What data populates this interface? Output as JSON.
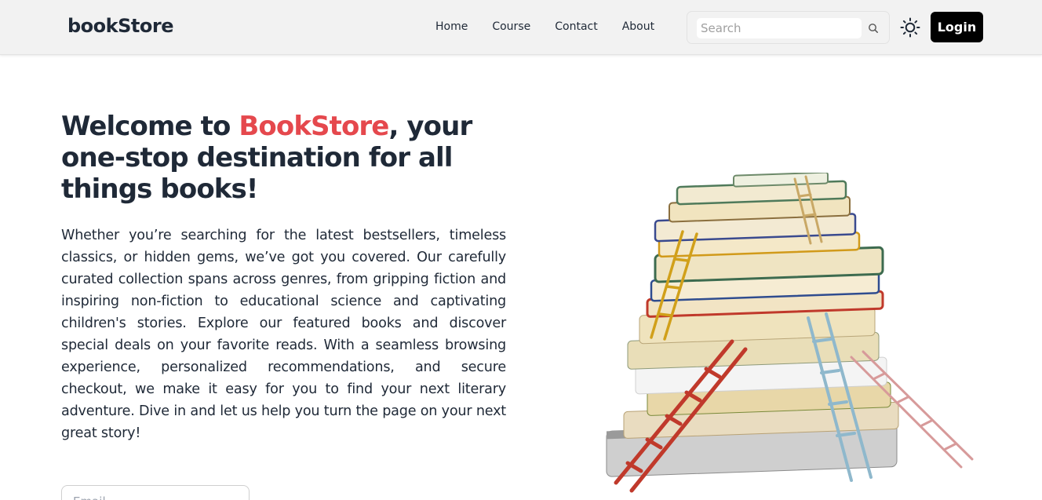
{
  "header": {
    "brand": "bookStore",
    "nav": [
      "Home",
      "Course",
      "Contact",
      "About"
    ],
    "search": {
      "placeholder": "Search",
      "value": "",
      "icon": "search-icon"
    },
    "theme_toggle_icon": "sun-icon",
    "login_label": "Login"
  },
  "hero": {
    "title_prefix": "Welcome to ",
    "title_accent": "BookStore",
    "title_suffix": ", your one-stop destination for all things books!",
    "description": "Whether you’re searching for the latest bestsellers, timeless classics, or hidden gems, we’ve got you covered. Our carefully curated collection spans across genres, from gripping fiction and inspiring non-fiction to educational science and captivating children's stories. Explore our featured books and discover special deals on your favorite reads. With a seamless browsing experience, personalized recommendations, and secure checkout, we make it easy for you to find your next literary adventure. Dive in and let us help you turn the page on your next great story!",
    "email_placeholder": "Email"
  },
  "colors": {
    "accent": "#e5484d",
    "text": "#1f2937",
    "navbar_bg": "#f2f2f2",
    "login_bg": "#000000"
  }
}
